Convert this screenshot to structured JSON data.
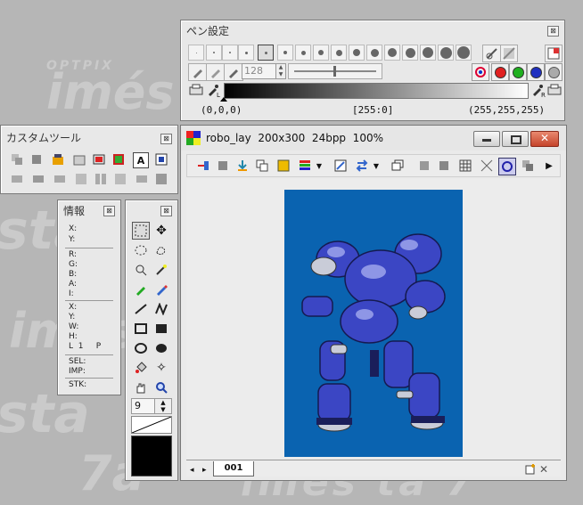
{
  "background_watermarks": [
    "OPTPIX",
    "imés",
    "sta",
    "imés",
    "sta",
    "7a",
    "imés ta 7"
  ],
  "pen_settings": {
    "title": "ペン設定",
    "size_value": "128",
    "gradient_left_label": "L",
    "gradient_right_label": "R",
    "coord_left": "(0,0,0)",
    "coord_mid": "[255:0]",
    "coord_right": "(255,255,255)",
    "color_dots": [
      "#e02020",
      "#20b020",
      "#2030c0"
    ]
  },
  "custom_tools": {
    "title": "カスタムツール"
  },
  "info_panel": {
    "title": "情報",
    "rows_a": [
      "X:",
      "Y:"
    ],
    "rows_b": [
      "R:",
      "G:",
      "B:",
      "A:",
      "I:"
    ],
    "rows_c": [
      "X:",
      "Y:",
      "W:",
      "H:",
      "L  1     P"
    ],
    "rows_d": [
      "SEL:",
      "IMP:"
    ],
    "rows_e": [
      "STK:"
    ]
  },
  "tools_panel": {
    "number_value": "9"
  },
  "document": {
    "title": "robo_lay  200x300  24bpp  100%",
    "canvas_color": "#0a63b0",
    "layer_tab": "001"
  }
}
